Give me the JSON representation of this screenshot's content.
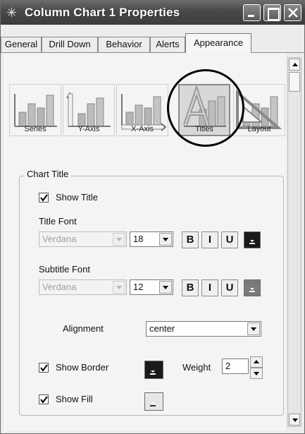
{
  "window": {
    "title": "Column Chart 1 Properties",
    "icon": "gear-star-icon"
  },
  "tabs": [
    {
      "label": "General"
    },
    {
      "label": "Drill Down"
    },
    {
      "label": "Behavior"
    },
    {
      "label": "Alerts"
    },
    {
      "label": "Appearance",
      "active": true
    }
  ],
  "categories": [
    {
      "label": "Series",
      "icon": "series-icon"
    },
    {
      "label": "Y-Axis",
      "icon": "y-axis-icon"
    },
    {
      "label": "X-Axis",
      "icon": "x-axis-icon"
    },
    {
      "label": "Titles",
      "icon": "titles-icon",
      "selected": true
    },
    {
      "label": "Layout",
      "icon": "layout-icon"
    }
  ],
  "chart_title": {
    "group_label": "Chart Title",
    "show_title_label": "Show Title",
    "show_title_checked": true,
    "title_font_label": "Title Font",
    "title_font": "Verdana",
    "title_size": "18",
    "subtitle_font_label": "Subtitle Font",
    "subtitle_font": "Verdana",
    "subtitle_size": "12",
    "bold_label": "B",
    "italic_label": "I",
    "underline_label": "U",
    "title_color": "#1a1a1a",
    "subtitle_color": "#7a7a7a",
    "alignment_label": "Alignment",
    "alignment_value": "center",
    "show_border_label": "Show Border",
    "show_border_checked": true,
    "border_color": "#1a1a1a",
    "weight_label": "Weight",
    "weight_value": "2",
    "show_fill_label": "Show Fill",
    "show_fill_checked": true,
    "fill_color": "#e6e6e6"
  }
}
